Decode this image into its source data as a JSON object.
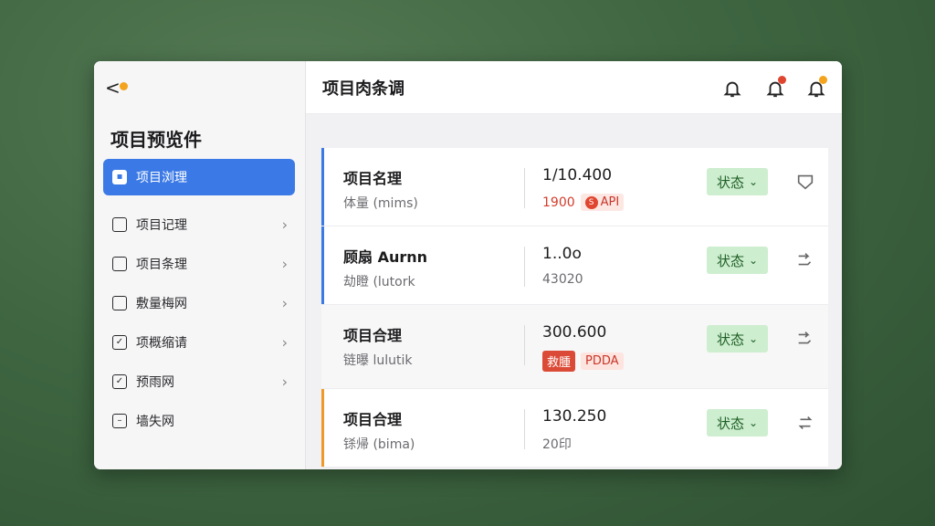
{
  "sidebar": {
    "back_label": "<",
    "title": "项目预览件",
    "items": [
      {
        "label": "项目浏理",
        "icon": "folder-icon",
        "active": true
      },
      {
        "label": "项目记理",
        "icon": "document-icon"
      },
      {
        "label": "项目条理",
        "icon": "calendar-icon"
      },
      {
        "label": "敷量梅网",
        "icon": "square-icon"
      },
      {
        "label": "项概缩请",
        "icon": "checkbox-icon"
      },
      {
        "label": "预雨网",
        "icon": "edit-check-icon"
      },
      {
        "label": "墙失网",
        "icon": "note-icon"
      }
    ]
  },
  "header": {
    "title": "项目肉条调",
    "icons": [
      "bell-icon",
      "bell-alert-icon",
      "bell-notification-icon"
    ]
  },
  "cards": [
    {
      "name": "项目名理",
      "sub": "体量 (mims)",
      "value": "1/10.400",
      "value2": "1900",
      "tag": "API",
      "status": "状态",
      "bar_color": "#3b7ae6"
    },
    {
      "name": "顾扇 Aurnn",
      "sub": "劫瞪 (lutork",
      "value": "1..0o",
      "value2": "43020",
      "status": "状态",
      "bar_color": "#3b7ae6"
    },
    {
      "name": "项目合理",
      "sub": "链曝 lulutik",
      "value": "300.600",
      "tags": [
        "救腫",
        "PDDA"
      ],
      "status": "状态"
    },
    {
      "name": "项目合理",
      "sub": "铩帰 (bima)",
      "value": "130.250",
      "value2": "20印",
      "status": "状态",
      "bar_color": "#f0982a"
    }
  ],
  "colors": {
    "accent": "#3b7ae6",
    "status_bg": "#cdeecf",
    "orange": "#f0982a",
    "badge_orange": "#f4a31c",
    "badge_red": "#e0452f"
  }
}
